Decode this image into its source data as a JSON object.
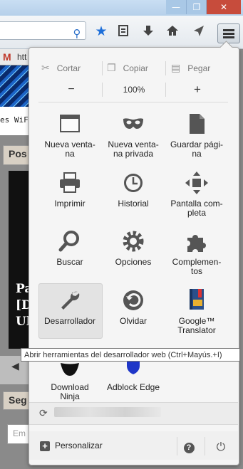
{
  "window": {
    "min_glyph": "—",
    "max_glyph": "❐",
    "close_glyph": "✕"
  },
  "page": {
    "gmail_prefix": "htt",
    "wifi_text": "es WiFi",
    "pos_tab": "Pos",
    "pa_lines": "Pa\n[D\nUl",
    "seg_tab": "Seg",
    "em_placeholder": "Em"
  },
  "edit": {
    "cut": "Cortar",
    "copy": "Copiar",
    "paste": "Pegar"
  },
  "zoom": {
    "minus": "−",
    "level": "100%",
    "plus": "+"
  },
  "tiles": [
    {
      "label": "Nueva venta-\nna",
      "icon": "new-window-icon"
    },
    {
      "label": "Nueva venta-\nna privada",
      "icon": "private-mask-icon"
    },
    {
      "label": "Guardar pági-\nna",
      "icon": "save-page-icon"
    },
    {
      "label": "Imprimir",
      "icon": "print-icon"
    },
    {
      "label": "Historial",
      "icon": "history-clock-icon"
    },
    {
      "label": "Pantalla com-\npleta",
      "icon": "fullscreen-icon"
    },
    {
      "label": "Buscar",
      "icon": "magnifier-icon"
    },
    {
      "label": "Opciones",
      "icon": "gear-icon"
    },
    {
      "label": "Complemen-\ntos",
      "icon": "puzzle-icon"
    },
    {
      "label": "Desarrollador",
      "icon": "wrench-icon"
    },
    {
      "label": "Olvidar",
      "icon": "forget-icon"
    },
    {
      "label": "Google™\nTranslator",
      "icon": "translator-book-icon"
    },
    {
      "label": "Download\nNinja",
      "icon": "download-ninja-icon"
    },
    {
      "label": "Adblock Edge",
      "icon": "adblock-shield-icon"
    }
  ],
  "tooltip": "Abrir herramientas del desarrollador web (Ctrl+Mayús.+I)",
  "footer": {
    "customize": "Personalizar",
    "help_glyph": "?",
    "quit_glyph": "⏻"
  },
  "colors": {
    "accent_blue": "#1e6fd9",
    "close_red": "#c74c3c",
    "forget_green": "#4a9a3a"
  }
}
